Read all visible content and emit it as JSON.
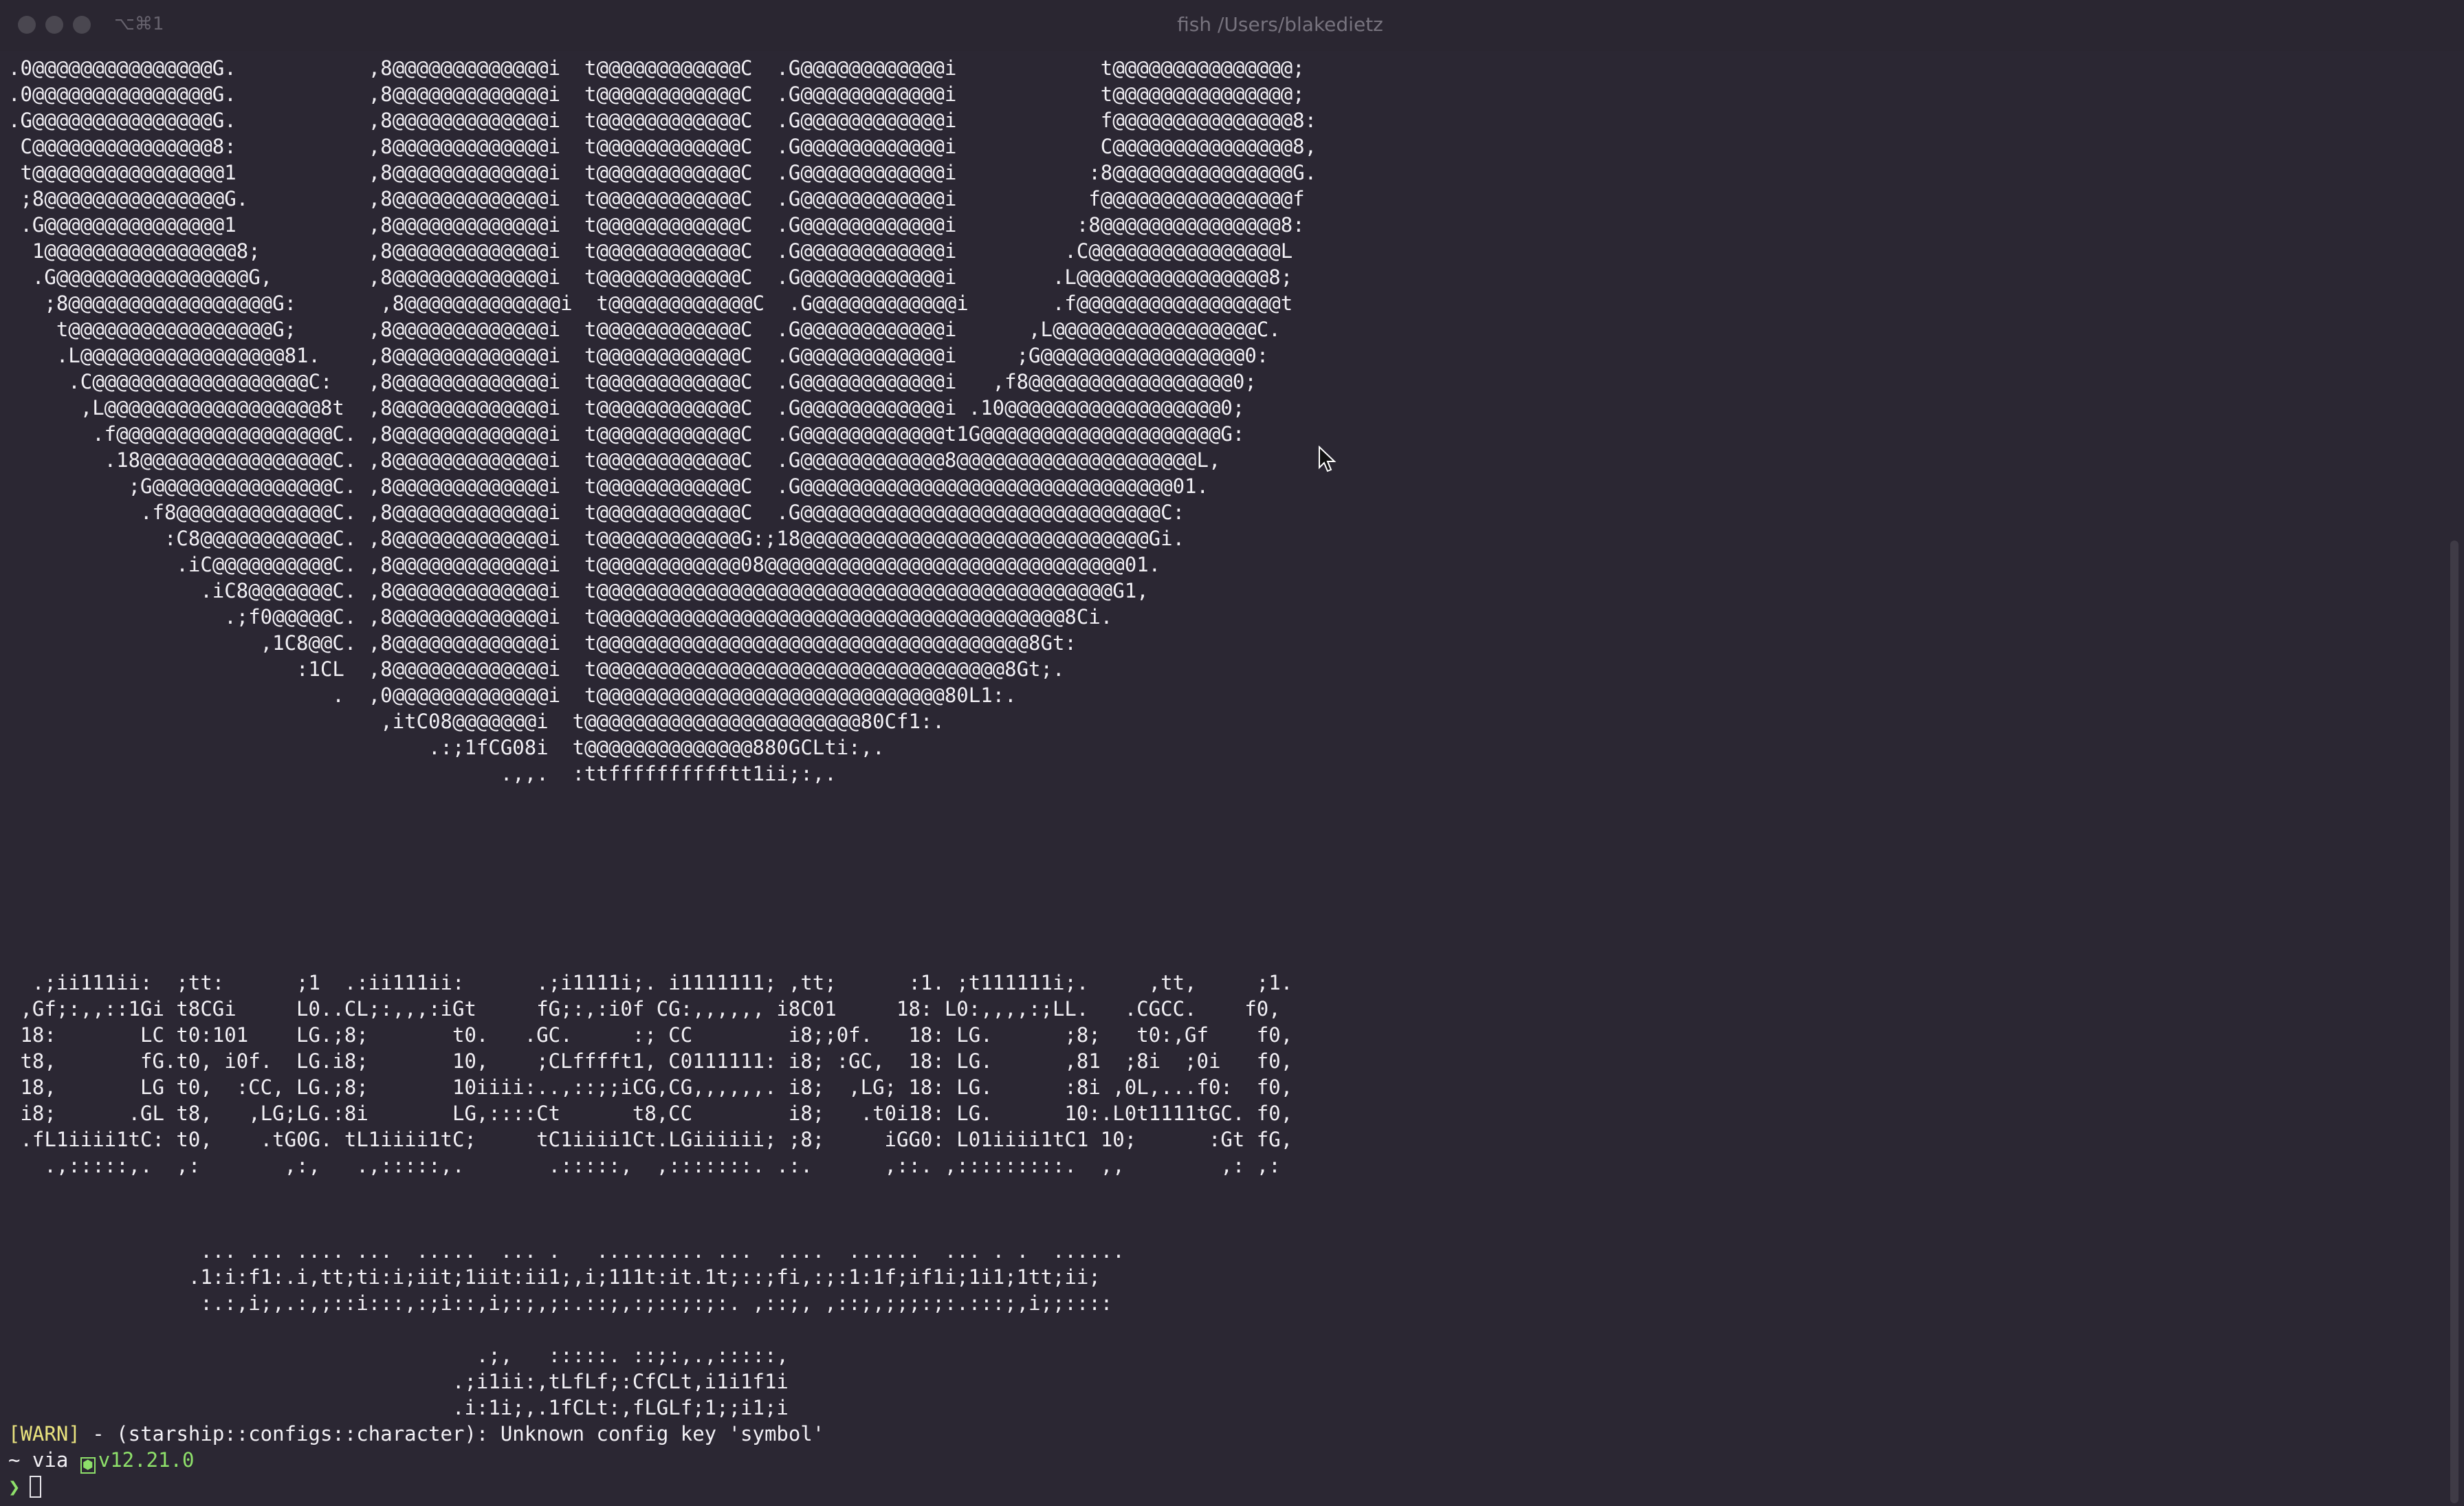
{
  "window": {
    "shortcut": "⌥⌘1",
    "title": "fish /Users/blakedietz"
  },
  "terminal": {
    "art_logo": ".0@@@@@@@@@@@@@@@G.           ,8@@@@@@@@@@@@@i  t@@@@@@@@@@@@C  .G@@@@@@@@@@@@i            t@@@@@@@@@@@@@@@;\n.0@@@@@@@@@@@@@@@G.           ,8@@@@@@@@@@@@@i  t@@@@@@@@@@@@C  .G@@@@@@@@@@@@i            t@@@@@@@@@@@@@@@;\n.G@@@@@@@@@@@@@@@G.           ,8@@@@@@@@@@@@@i  t@@@@@@@@@@@@C  .G@@@@@@@@@@@@i            f@@@@@@@@@@@@@@@8:\n C@@@@@@@@@@@@@@@8:           ,8@@@@@@@@@@@@@i  t@@@@@@@@@@@@C  .G@@@@@@@@@@@@i            C@@@@@@@@@@@@@@@8,\n t@@@@@@@@@@@@@@@@1           ,8@@@@@@@@@@@@@i  t@@@@@@@@@@@@C  .G@@@@@@@@@@@@i           :8@@@@@@@@@@@@@@@G.\n ;8@@@@@@@@@@@@@@@G.          ,8@@@@@@@@@@@@@i  t@@@@@@@@@@@@C  .G@@@@@@@@@@@@i           f@@@@@@@@@@@@@@@@f\n .G@@@@@@@@@@@@@@@1           ,8@@@@@@@@@@@@@i  t@@@@@@@@@@@@C  .G@@@@@@@@@@@@i          :8@@@@@@@@@@@@@@@8:\n  1@@@@@@@@@@@@@@@@8;         ,8@@@@@@@@@@@@@i  t@@@@@@@@@@@@C  .G@@@@@@@@@@@@i         .C@@@@@@@@@@@@@@@@L\n  .G@@@@@@@@@@@@@@@@G,        ,8@@@@@@@@@@@@@i  t@@@@@@@@@@@@C  .G@@@@@@@@@@@@i        .L@@@@@@@@@@@@@@@@8;\n   ;8@@@@@@@@@@@@@@@@@G:       ,8@@@@@@@@@@@@@i  t@@@@@@@@@@@@C  .G@@@@@@@@@@@@i       .f@@@@@@@@@@@@@@@@@t\n    t@@@@@@@@@@@@@@@@@G;      ,8@@@@@@@@@@@@@i  t@@@@@@@@@@@@C  .G@@@@@@@@@@@@i      ,L@@@@@@@@@@@@@@@@@C.\n    .L@@@@@@@@@@@@@@@@@81.    ,8@@@@@@@@@@@@@i  t@@@@@@@@@@@@C  .G@@@@@@@@@@@@i     ;G@@@@@@@@@@@@@@@@@0:\n     .C@@@@@@@@@@@@@@@@@@C:   ,8@@@@@@@@@@@@@i  t@@@@@@@@@@@@C  .G@@@@@@@@@@@@i   ,f8@@@@@@@@@@@@@@@@@0;\n      ,L@@@@@@@@@@@@@@@@@@8t  ,8@@@@@@@@@@@@@i  t@@@@@@@@@@@@C  .G@@@@@@@@@@@@i .10@@@@@@@@@@@@@@@@@@0;\n       .f@@@@@@@@@@@@@@@@@@C. ,8@@@@@@@@@@@@@i  t@@@@@@@@@@@@C  .G@@@@@@@@@@@@t1G@@@@@@@@@@@@@@@@@@@@G:\n        .18@@@@@@@@@@@@@@@@C. ,8@@@@@@@@@@@@@i  t@@@@@@@@@@@@C  .G@@@@@@@@@@@@8@@@@@@@@@@@@@@@@@@@@L,\n          ;G@@@@@@@@@@@@@@@C. ,8@@@@@@@@@@@@@i  t@@@@@@@@@@@@C  .G@@@@@@@@@@@@@@@@@@@@@@@@@@@@@@@01.\n           .f8@@@@@@@@@@@@@C. ,8@@@@@@@@@@@@@i  t@@@@@@@@@@@@C  .G@@@@@@@@@@@@@@@@@@@@@@@@@@@@@@C:\n             :C8@@@@@@@@@@@C. ,8@@@@@@@@@@@@@i  t@@@@@@@@@@@@G:;18@@@@@@@@@@@@@@@@@@@@@@@@@@@@@Gi.\n              .iC@@@@@@@@@@C. ,8@@@@@@@@@@@@@i  t@@@@@@@@@@@@08@@@@@@@@@@@@@@@@@@@@@@@@@@@@@@01.\n                .iC8@@@@@@@C. ,8@@@@@@@@@@@@@i  t@@@@@@@@@@@@@@@@@@@@@@@@@@@@@@@@@@@@@@@@@@@G1,\n                  .;f0@@@@@C. ,8@@@@@@@@@@@@@i  t@@@@@@@@@@@@@@@@@@@@@@@@@@@@@@@@@@@@@@@8Ci.\n                     ,1C8@@C. ,8@@@@@@@@@@@@@i  t@@@@@@@@@@@@@@@@@@@@@@@@@@@@@@@@@@@@8Gt:\n                        :1CL  ,8@@@@@@@@@@@@@i  t@@@@@@@@@@@@@@@@@@@@@@@@@@@@@@@@@@8Gt;.\n                           .  ,0@@@@@@@@@@@@@i  t@@@@@@@@@@@@@@@@@@@@@@@@@@@@@80L1:.\n                               ,itC08@@@@@@@i  t@@@@@@@@@@@@@@@@@@@@@@@80Cf1:.\n                                   .:;1fCG08i  t@@@@@@@@@@@@@@880GCLti:,.\n                                         .,,.  :ttfffffffffftt1ii;:,.",
    "art_name": "  .;ii111ii:  ;tt:      ;1  .:ii111ii:      .;i1111i;. i1111111; ,tt;      :1. ;t111111i;.     ,tt,     ;1.\n ,Gf;:,,::1Gi t8CGi     L0..CL;:,,,:iGt     fG;:,:i0f CG:,,,,,, i8C01     18: L0:,,,,:;LL.   .CGCC.    f0,\n 18:       LC t0:101    LG.;8;       t0.   .GC.     :; CC        i8;;0f.   18: LG.      ;8;   t0:,Gf    f0,\n t8,       fG.t0, i0f.  LG.i8;       10,    ;CLfffft1, C0111111: i8; :GC,  18: LG.      ,81  ;8i  ;0i   f0,\n 18,       LG t0,  :CC, LG.;8;       10iiii:..,::;;iCG,CG,,,,,,. i8;  ,LG; 18: LG.      :8i ,0L,...f0:  f0,\n i8;      .GL t8,   ,LG;LG.:8i       LG,::::Ct      t8,CC        i8;   .t0i18: LG.      10:.L0t1111tGC. f0,\n .fL1iiii1tC: t0,    .tG0G. tL1iiii1tC;     tC1iiii1Ct.LGiiiiii; ;8;     iGG0: L01iiii1tC1 10;      :Gt fG,\n   .,:::::,.  ,:       ,:,   .,:::::,.       .:::::,  ,:::::::. .:.      ,::. ,:::::::::.  ,,        ,: ,:",
    "art_small": "                ... ... .... ...  .....  ... .   ......... ...  ....  ......  ... . .  ......\n               .1:i:f1:.i,tt;ti:i;iit;1iit:ii1;,i;111t:it.1t;::;fi,:;:1:1f;if1i;1i1;1tt;ii;\n                :.:,i;,.:,;::i:::,:;i::,i;:;,;:.::;,:;::;:;:. ,::;, ,::;,;;;:;:.:::;,i;;::::\n\n                                       .;,   :::::. ::;:,.,:::::,\n                                     .;i1ii:,tLfLf;:CfCLt,i1i1f1i\n                                     .i:1i;,.1fCLt:,fLGLf;1;;i1;i",
    "warn_tag": "[WARN]",
    "warn_text": " - (starship::configs::character): Unknown config key 'symbol'",
    "prompt_dir": "~ via ",
    "node_icon": "⬢",
    "node_version": "v12.21.0",
    "prompt_char": "❯"
  },
  "colors": {
    "background": "#2b2733",
    "text": "#f2f0f5",
    "warn": "#e9e27e",
    "version": "#8ee06a"
  }
}
